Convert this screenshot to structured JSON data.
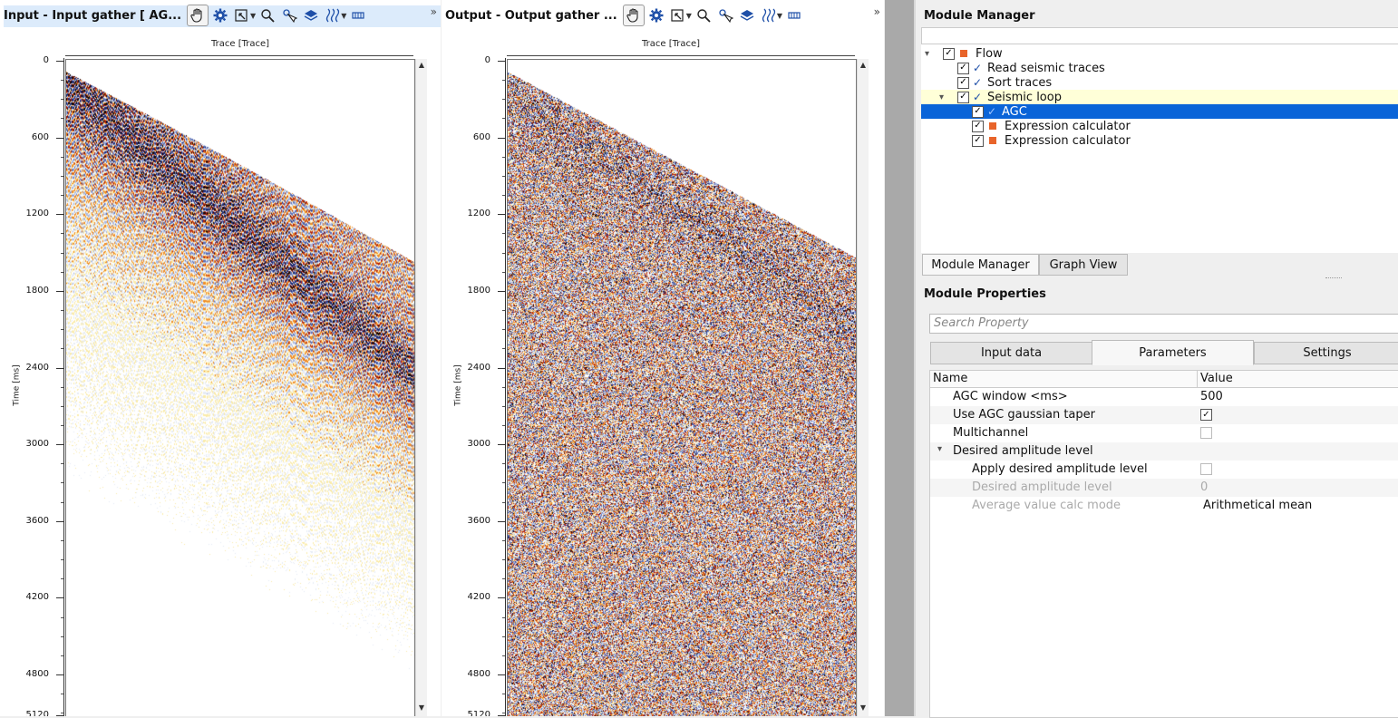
{
  "viewers": [
    {
      "title": "Input - Input gather [ AG...",
      "trace_label": "Trace [Trace]",
      "ylabel": "Time [ms]",
      "ticks": [
        "0",
        "600",
        "1200",
        "1800",
        "2400",
        "3000",
        "3600",
        "4200",
        "4800",
        "5120"
      ]
    },
    {
      "title": "Output - Output gather ...",
      "trace_label": "Trace [Trace]",
      "ylabel": "Time [ms]",
      "ticks": [
        "0",
        "600",
        "1200",
        "1800",
        "2400",
        "3000",
        "3600",
        "4200",
        "4800",
        "5120"
      ]
    }
  ],
  "overflow_glyph": "»",
  "module_manager": {
    "title": "Module Manager",
    "tree": [
      {
        "label": "Flow",
        "level": 0,
        "expander": "▾",
        "checked": true,
        "icon": "orange-square"
      },
      {
        "label": "Read seismic traces",
        "level": 1,
        "checked": true,
        "icon": "blue-check"
      },
      {
        "label": "Sort traces",
        "level": 1,
        "checked": true,
        "icon": "blue-check"
      },
      {
        "label": "Seismic loop",
        "level": 1,
        "expander": "▾",
        "checked": true,
        "icon": "blue-check",
        "highlight": "yellow"
      },
      {
        "label": "AGC",
        "level": 2,
        "checked": true,
        "icon": "blue-check",
        "highlight": "selected"
      },
      {
        "label": "Expression calculator",
        "level": 2,
        "checked": true,
        "icon": "orange-square"
      },
      {
        "label": "Expression calculator",
        "level": 2,
        "checked": true,
        "icon": "orange-square"
      }
    ],
    "tabs": [
      "Module Manager",
      "Graph View"
    ],
    "active_tab": 0
  },
  "module_properties": {
    "title": "Module Properties",
    "search_placeholder": "Search Property",
    "tabs": [
      "Input data",
      "Parameters",
      "Settings"
    ],
    "active_tab": 1,
    "columns": [
      "Name",
      "Value"
    ],
    "rows": [
      {
        "name": "AGC window <ms>",
        "value": "500",
        "type": "text"
      },
      {
        "name": "Use AGC gaussian taper",
        "value": "",
        "type": "checkbox",
        "checked": true
      },
      {
        "name": "Multichannel",
        "value": "",
        "type": "checkbox",
        "checked": false
      },
      {
        "name": "Desired amplitude level",
        "value": "",
        "type": "group",
        "expander": "▾"
      },
      {
        "name": "Apply desired amplitude level",
        "value": "",
        "type": "checkbox",
        "checked": false,
        "indent": true
      },
      {
        "name": "Desired amplitude level",
        "value": "0",
        "type": "text",
        "indent": true,
        "disabled": true
      },
      {
        "name": "Average value calc mode",
        "value": "Arithmetical mean",
        "type": "text",
        "indent": true,
        "disabled": true
      }
    ]
  },
  "colors": {
    "selected": "#0a64d8",
    "highlight_yellow": "#ffffd8",
    "viewer_title_bg": "#dcebfb"
  }
}
